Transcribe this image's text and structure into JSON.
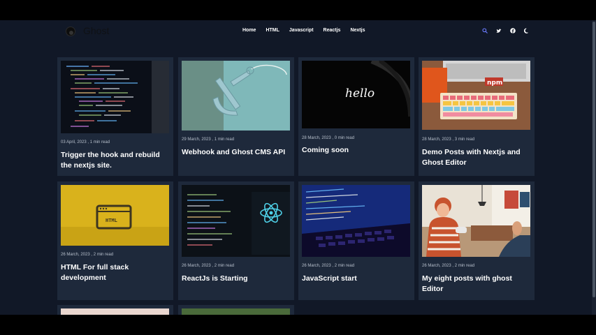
{
  "brand": {
    "name": "Ghost"
  },
  "nav": {
    "links": [
      "Home",
      "HTML",
      "Javascript",
      "Reactjs",
      "Nextjs"
    ],
    "icons": [
      "search-icon",
      "twitter-icon",
      "facebook-icon",
      "moon-icon"
    ]
  },
  "colors": {
    "background": "#111827",
    "card": "#1e293b",
    "accent_search": "#6b7cff"
  },
  "posts": [
    {
      "date": "03 April, 2023",
      "read": "1 min read",
      "title": "Trigger the hook and rebuild the nextjs site."
    },
    {
      "date": "29 March, 2023",
      "read": "1 min read",
      "title": "Webhook and Ghost CMS API"
    },
    {
      "date": "28 March, 2023",
      "read": "0 min read",
      "title": "Coming soon",
      "image_text": "hello"
    },
    {
      "date": "28 March, 2023",
      "read": "3 min read",
      "title": "Demo Posts with Nextjs and Ghost Editor",
      "image_text": "npm"
    },
    {
      "date": "26 March, 2023",
      "read": "2 min read",
      "title": "HTML For full stack development",
      "image_text": "HTML"
    },
    {
      "date": "26 March, 2023",
      "read": "2 min read",
      "title": "ReactJs is Starting"
    },
    {
      "date": "26 March, 2023",
      "read": "2 min read",
      "title": "JavaScript start"
    },
    {
      "date": "26 March, 2023",
      "read": "2 min read",
      "title": "My eight posts with ghost Editor"
    }
  ],
  "separator": " , "
}
